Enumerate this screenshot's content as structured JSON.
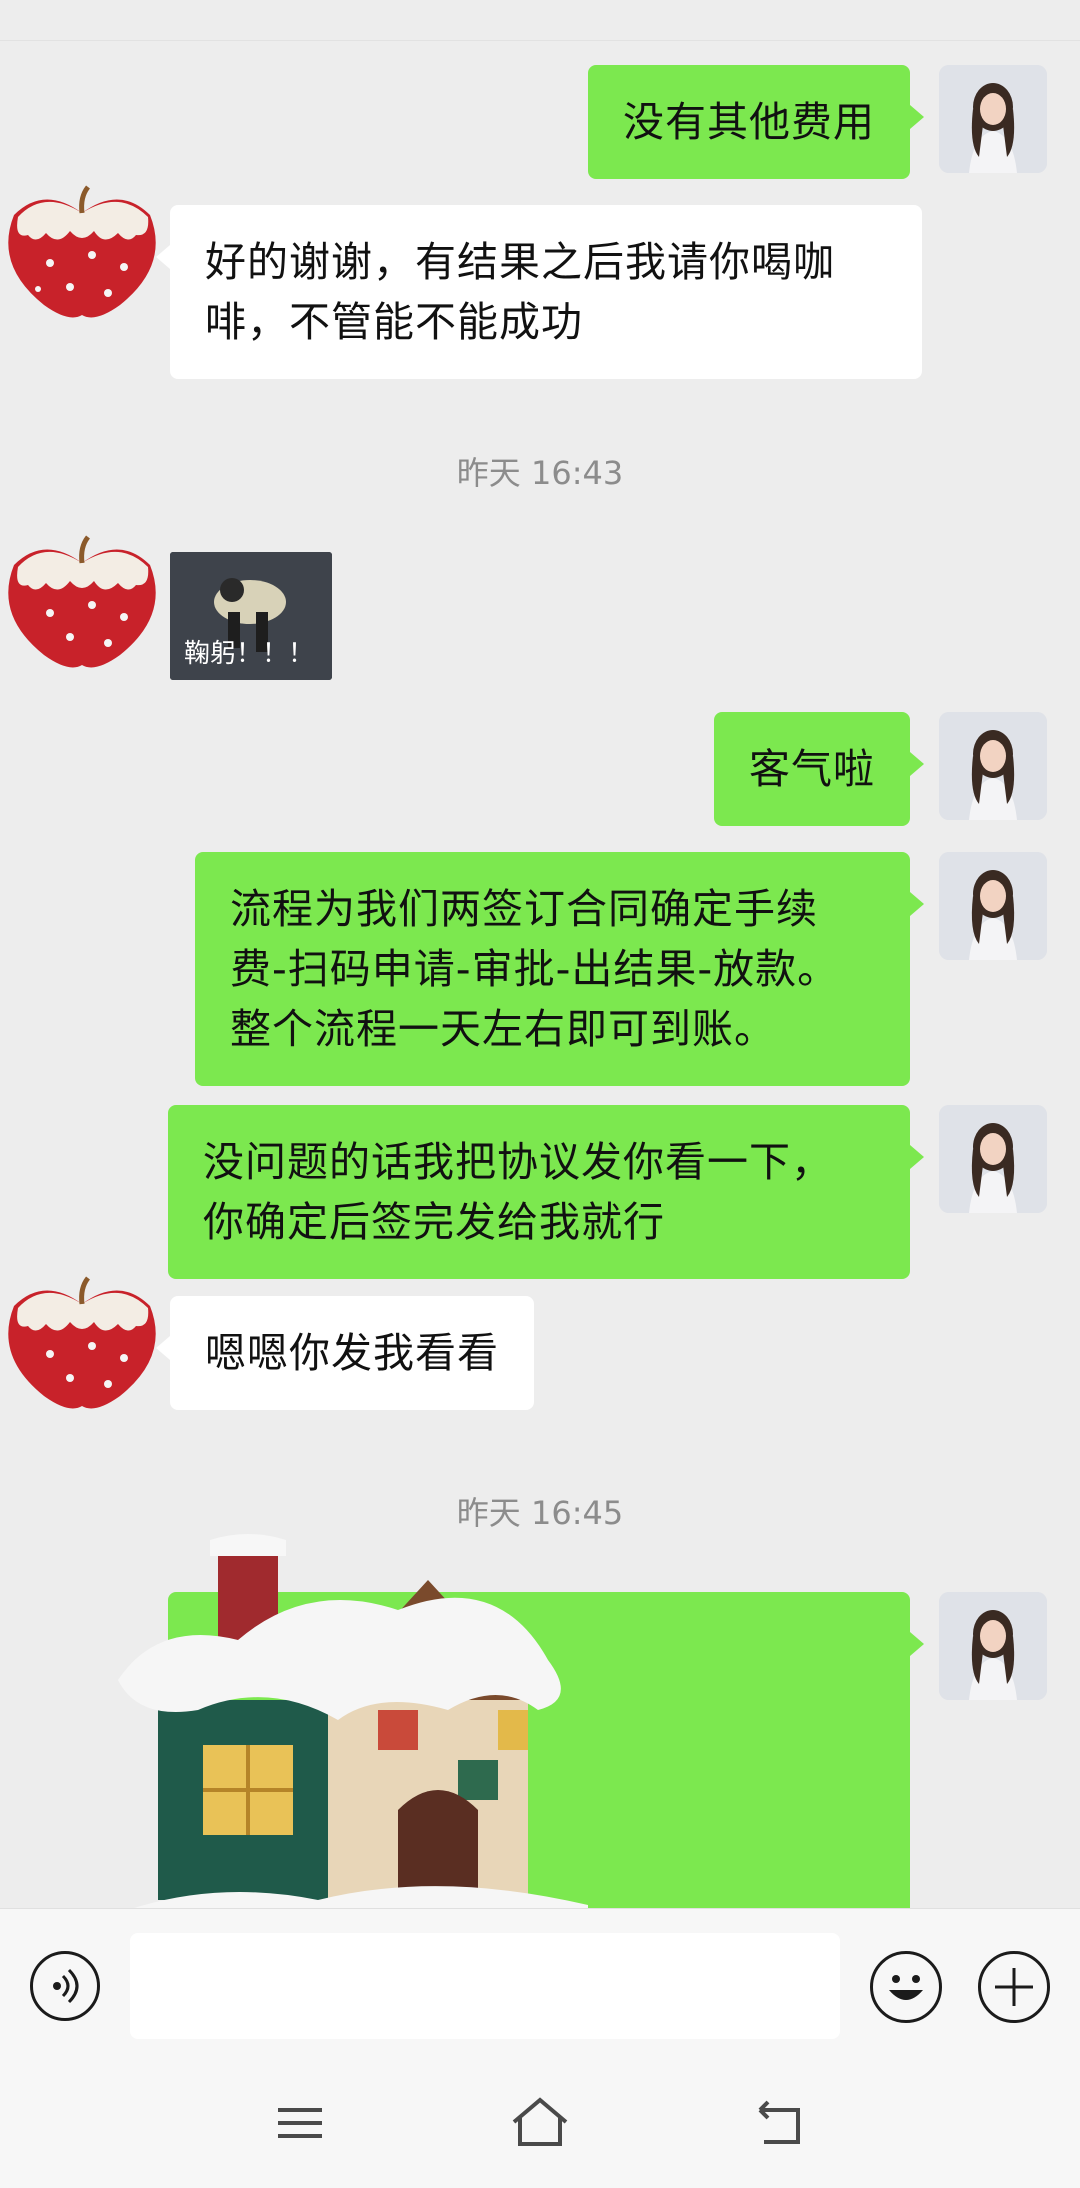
{
  "messages": {
    "m1": "没有其他费用",
    "m2": "好的谢谢，有结果之后我请你喝咖\n啡，不管能不能成功",
    "ts1": "昨天 16:43",
    "sticker_caption": "鞠躬！！！",
    "m3": "客气啦",
    "m4": "流程为我们两签订合同确定手续\n费-扫码申请-审批-出结果-放款。\n整个流程一天左右即可到账。",
    "m5": "没问题的话我把协议发你看一下，\n你确定后签完发给我就行",
    "m6": "嗯嗯你发我看看",
    "ts2": "昨天 16:45"
  },
  "input": {
    "value": "",
    "placeholder": ""
  },
  "icons": {
    "voice": "voice-icon",
    "emoji": "emoji-icon",
    "plus": "plus-icon",
    "nav_menu": "menu-icon",
    "nav_home": "home-icon",
    "nav_back": "back-icon"
  },
  "colors": {
    "me_bubble": "#7ce84f",
    "them_bubble": "#ffffff",
    "background": "#ededed"
  }
}
